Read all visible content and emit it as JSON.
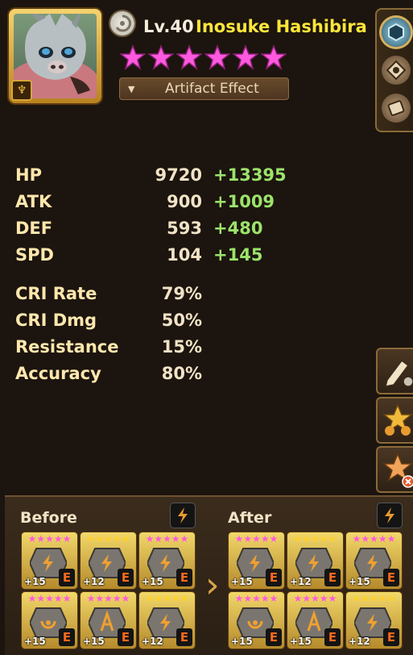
{
  "monster": {
    "level": "Lv.40",
    "name": "Inosuke Hashibira",
    "stars": 6,
    "star_color": "#ff5adf"
  },
  "artifact_button": {
    "label": "Artifact Effect"
  },
  "stats": [
    {
      "label": "HP",
      "value": "9720",
      "bonus": "+13395"
    },
    {
      "label": "ATK",
      "value": "900",
      "bonus": "+1009"
    },
    {
      "label": "DEF",
      "value": "593",
      "bonus": "+480"
    },
    {
      "label": "SPD",
      "value": "104",
      "bonus": "+145"
    }
  ],
  "sub_stats": [
    {
      "label": "CRI Rate",
      "value": "79%"
    },
    {
      "label": "CRI Dmg",
      "value": "50%"
    },
    {
      "label": "Resistance",
      "value": "15%"
    },
    {
      "label": "Accuracy",
      "value": "80%"
    }
  ],
  "side_tabs": [
    "rune-icon",
    "artifact-icon",
    "scroll-icon"
  ],
  "actions": [
    "edit-icon",
    "rune-management-icon",
    "unequip-icon"
  ],
  "comparison": {
    "before_label": "Before",
    "after_label": "After",
    "before": [
      {
        "level": "+15",
        "grade": "E",
        "star_color": "pink",
        "symbol": "energy"
      },
      {
        "level": "+12",
        "grade": "E",
        "star_color": "gold",
        "symbol": "energy"
      },
      {
        "level": "+15",
        "grade": "E",
        "star_color": "pink",
        "symbol": "energy"
      },
      {
        "level": "+15",
        "grade": "E",
        "star_color": "pink",
        "symbol": "focus"
      },
      {
        "level": "+15",
        "grade": "E",
        "star_color": "pink",
        "symbol": "accuracy"
      },
      {
        "level": "+12",
        "grade": "E",
        "star_color": "gold",
        "symbol": "energy"
      }
    ],
    "after": [
      {
        "level": "+15",
        "grade": "E",
        "star_color": "pink",
        "symbol": "energy"
      },
      {
        "level": "+12",
        "grade": "E",
        "star_color": "gold",
        "symbol": "energy"
      },
      {
        "level": "+15",
        "grade": "E",
        "star_color": "pink",
        "symbol": "energy"
      },
      {
        "level": "+15",
        "grade": "E",
        "star_color": "pink",
        "symbol": "focus"
      },
      {
        "level": "+15",
        "grade": "E",
        "star_color": "pink",
        "symbol": "accuracy"
      },
      {
        "level": "+12",
        "grade": "E",
        "star_color": "gold",
        "symbol": "energy"
      }
    ]
  }
}
